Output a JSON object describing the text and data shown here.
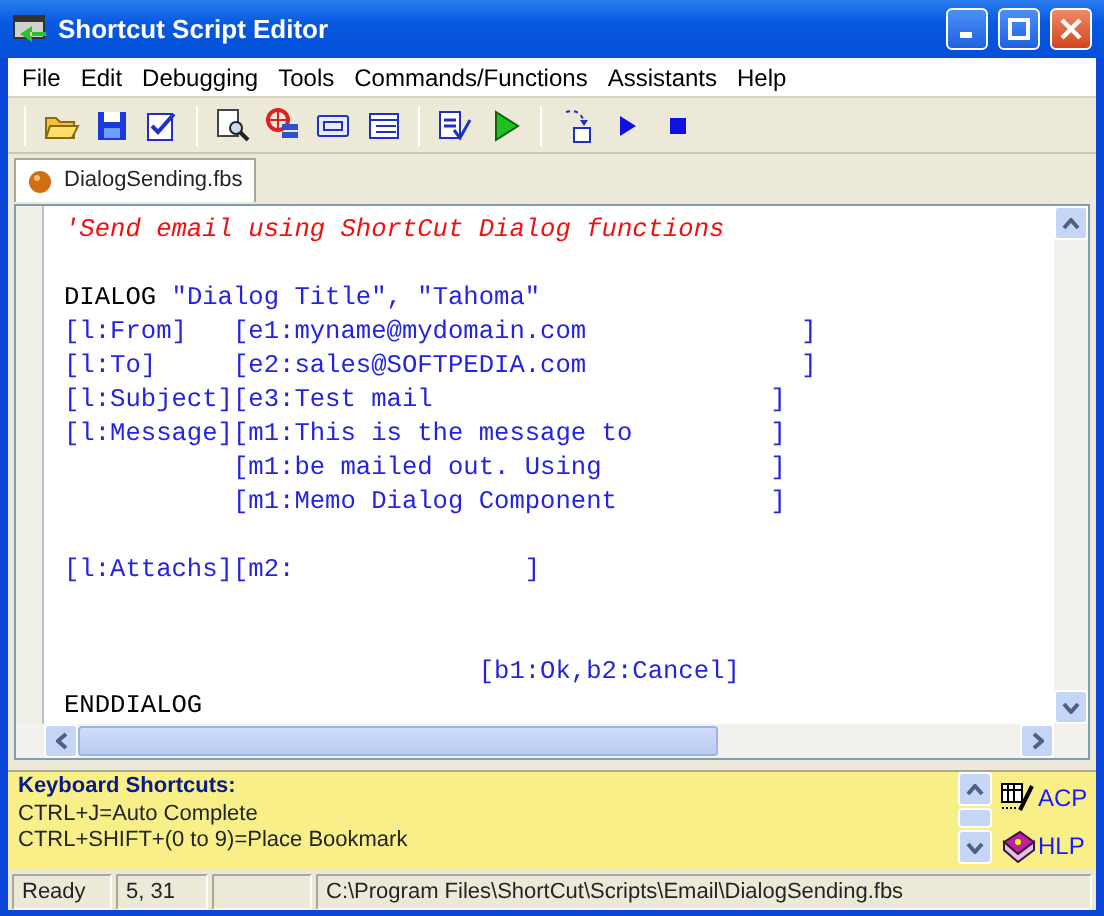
{
  "window": {
    "title": "Shortcut Script Editor"
  },
  "menu": [
    "File",
    "Edit",
    "Debugging",
    "Tools",
    "Commands/Functions",
    "Assistants",
    "Help"
  ],
  "tabs": [
    {
      "label": "DialogSending.fbs",
      "selected": true
    }
  ],
  "editor": {
    "lines": [
      {
        "kind": "code",
        "segments": [
          {
            "kind": "comment",
            "text": "'Send email using ShortCut Dialog functions"
          }
        ]
      },
      {
        "kind": "blank"
      },
      {
        "kind": "code",
        "segments": [
          {
            "kind": "keyword",
            "text": "DIALOG "
          },
          {
            "kind": "string",
            "text": "\"Dialog Title\", \"Tahoma\""
          }
        ]
      },
      {
        "kind": "code",
        "segments": [
          {
            "kind": "string",
            "text": "[l:From]   [e1:myname@mydomain.com              ]"
          }
        ]
      },
      {
        "kind": "code",
        "segments": [
          {
            "kind": "string",
            "text": "[l:To]     [e2:sales@SOFTPEDIA.com              ]"
          }
        ]
      },
      {
        "kind": "code",
        "segments": [
          {
            "kind": "string",
            "text": "[l:Subject][e3:Test mail                      ]"
          }
        ]
      },
      {
        "kind": "code",
        "segments": [
          {
            "kind": "string",
            "text": "[l:Message][m1:This is the message to         ]"
          }
        ]
      },
      {
        "kind": "code",
        "segments": [
          {
            "kind": "string",
            "text": "           [m1:be mailed out. Using           ]"
          }
        ]
      },
      {
        "kind": "code",
        "segments": [
          {
            "kind": "string",
            "text": "           [m1:Memo Dialog Component          ]"
          }
        ]
      },
      {
        "kind": "blank"
      },
      {
        "kind": "code",
        "segments": [
          {
            "kind": "string",
            "text": "[l:Attachs][m2:               ]"
          }
        ]
      },
      {
        "kind": "blank"
      },
      {
        "kind": "blank"
      },
      {
        "kind": "code",
        "segments": [
          {
            "kind": "string",
            "text": "                           [b1:Ok,b2:Cancel]"
          }
        ]
      },
      {
        "kind": "code",
        "segments": [
          {
            "kind": "keyword",
            "text": "ENDDIALOG"
          }
        ]
      }
    ]
  },
  "shortcuts": {
    "title": "Keyboard Shortcuts:",
    "lines": [
      "CTRL+J=Auto Complete",
      "CTRL+SHIFT+(0 to 9)=Place Bookmark"
    ],
    "links": [
      "ACP",
      "HLP"
    ]
  },
  "status_bar": [
    {
      "kind": "text",
      "text": "Ready"
    },
    {
      "kind": "text",
      "text": "5, 31"
    },
    {
      "kind": "blank"
    },
    {
      "kind": "text",
      "text": "C:\\Program Files\\ShortCut\\Scripts\\Email\\DialogSending.fbs"
    }
  ]
}
